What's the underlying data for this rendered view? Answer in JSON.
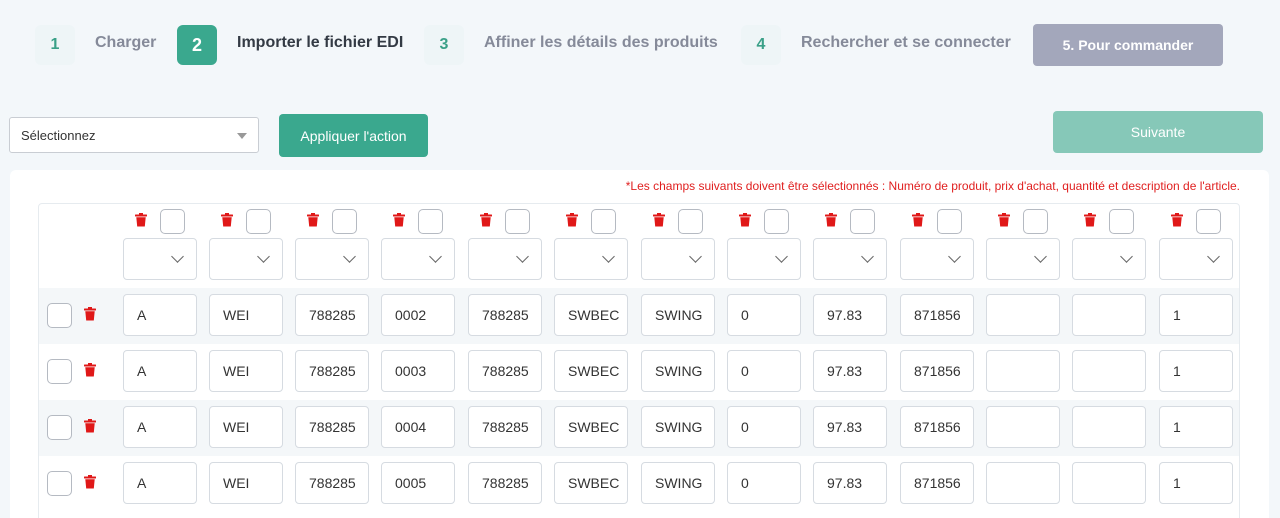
{
  "steps": [
    {
      "number": "1",
      "label": "Charger"
    },
    {
      "number": "2",
      "label": "Importer le fichier EDI"
    },
    {
      "number": "3",
      "label": "Affiner les détails des produits"
    },
    {
      "number": "4",
      "label": "Rechercher et se connecter"
    }
  ],
  "step5_label": "5. Pour commander",
  "toolbar": {
    "select_value": "Sélectionnez",
    "apply_label": "Appliquer l'action",
    "next_label": "Suivante"
  },
  "note": "*Les champs suivants doivent être sélectionnés : Numéro de produit, prix d'achat, quantité et description de l'article.",
  "icons": {
    "delete": "trash-icon",
    "dropdown": "chevron-down-icon"
  },
  "colors": {
    "accent": "#3aa88e",
    "danger": "#e02020",
    "disabled": "#a3a7bb"
  },
  "rows": [
    [
      "A",
      "WEI",
      "788285",
      "0002",
      "788285",
      "SWBEC",
      "SWING",
      "0",
      "97.83",
      "871856",
      "",
      "",
      "1"
    ],
    [
      "A",
      "WEI",
      "788285",
      "0003",
      "788285",
      "SWBEC",
      "SWING",
      "0",
      "97.83",
      "871856",
      "",
      "",
      "1"
    ],
    [
      "A",
      "WEI",
      "788285",
      "0004",
      "788285",
      "SWBEC",
      "SWING",
      "0",
      "97.83",
      "871856",
      "",
      "",
      "1"
    ],
    [
      "A",
      "WEI",
      "788285",
      "0005",
      "788285",
      "SWBEC",
      "SWING",
      "0",
      "97.83",
      "871856",
      "",
      "",
      "1"
    ]
  ]
}
